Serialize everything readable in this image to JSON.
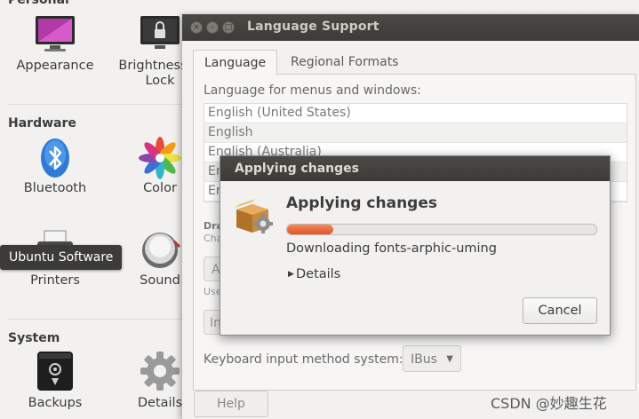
{
  "settings": {
    "sections": {
      "personal": "Personal",
      "hardware": "Hardware",
      "system": "System"
    },
    "tiles": {
      "appearance": "Appearance",
      "brightness": "Brightness &\nLock",
      "bluetooth": "Bluetooth",
      "color": "Color",
      "printers": "Printers",
      "sound": "Sound",
      "backups": "Backups",
      "details": "Details"
    },
    "tooltip": "Ubuntu Software"
  },
  "language_window": {
    "title": "Language Support",
    "tabs": [
      "Language",
      "Regional Formats"
    ],
    "menus_label": "Language for menus and windows:",
    "languages": [
      "English (United States)",
      "English",
      "English (Australia)",
      "En",
      "En"
    ],
    "partial": {
      "drag": "Dra",
      "changes": "Cha",
      "apply": "A",
      "use": "Use",
      "install": "In"
    },
    "keyboard_label": "Keyboard input method system:",
    "keyboard_value": "IBus",
    "help_button": "Help"
  },
  "dialog": {
    "title": "Applying changes",
    "heading": "Applying changes",
    "progress": 0.15,
    "status": "Downloading fonts-arphic-uming",
    "details": "Details",
    "cancel": "Cancel"
  },
  "watermark": "CSDN @妙趣生花",
  "colors": {
    "titlebar": "#3c3b37",
    "progress_fill": "#e95420",
    "tooltip_bg": "#3c3b37"
  }
}
